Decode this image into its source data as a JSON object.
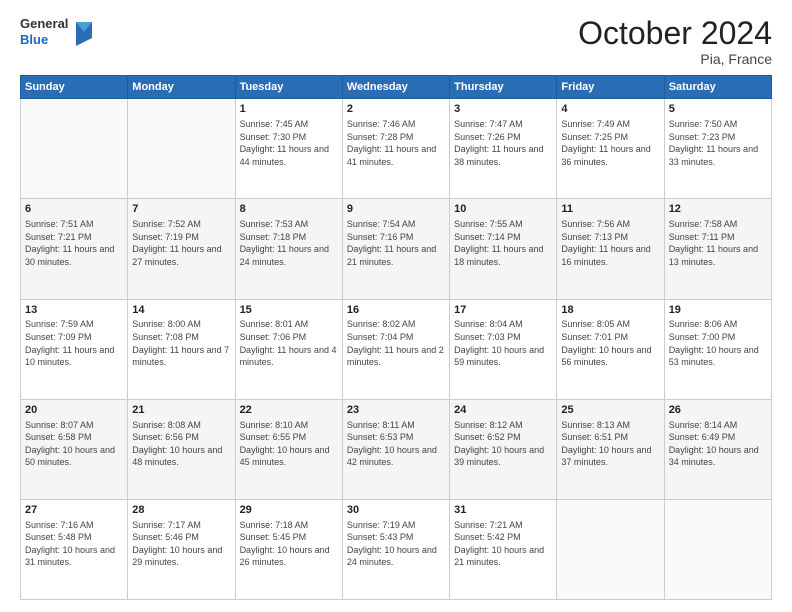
{
  "logo": {
    "general": "General",
    "blue": "Blue"
  },
  "header": {
    "month": "October 2024",
    "location": "Pia, France"
  },
  "days_of_week": [
    "Sunday",
    "Monday",
    "Tuesday",
    "Wednesday",
    "Thursday",
    "Friday",
    "Saturday"
  ],
  "weeks": [
    [
      {
        "day": "",
        "info": ""
      },
      {
        "day": "",
        "info": ""
      },
      {
        "day": "1",
        "info": "Sunrise: 7:45 AM\nSunset: 7:30 PM\nDaylight: 11 hours and 44 minutes."
      },
      {
        "day": "2",
        "info": "Sunrise: 7:46 AM\nSunset: 7:28 PM\nDaylight: 11 hours and 41 minutes."
      },
      {
        "day": "3",
        "info": "Sunrise: 7:47 AM\nSunset: 7:26 PM\nDaylight: 11 hours and 38 minutes."
      },
      {
        "day": "4",
        "info": "Sunrise: 7:49 AM\nSunset: 7:25 PM\nDaylight: 11 hours and 36 minutes."
      },
      {
        "day": "5",
        "info": "Sunrise: 7:50 AM\nSunset: 7:23 PM\nDaylight: 11 hours and 33 minutes."
      }
    ],
    [
      {
        "day": "6",
        "info": "Sunrise: 7:51 AM\nSunset: 7:21 PM\nDaylight: 11 hours and 30 minutes."
      },
      {
        "day": "7",
        "info": "Sunrise: 7:52 AM\nSunset: 7:19 PM\nDaylight: 11 hours and 27 minutes."
      },
      {
        "day": "8",
        "info": "Sunrise: 7:53 AM\nSunset: 7:18 PM\nDaylight: 11 hours and 24 minutes."
      },
      {
        "day": "9",
        "info": "Sunrise: 7:54 AM\nSunset: 7:16 PM\nDaylight: 11 hours and 21 minutes."
      },
      {
        "day": "10",
        "info": "Sunrise: 7:55 AM\nSunset: 7:14 PM\nDaylight: 11 hours and 18 minutes."
      },
      {
        "day": "11",
        "info": "Sunrise: 7:56 AM\nSunset: 7:13 PM\nDaylight: 11 hours and 16 minutes."
      },
      {
        "day": "12",
        "info": "Sunrise: 7:58 AM\nSunset: 7:11 PM\nDaylight: 11 hours and 13 minutes."
      }
    ],
    [
      {
        "day": "13",
        "info": "Sunrise: 7:59 AM\nSunset: 7:09 PM\nDaylight: 11 hours and 10 minutes."
      },
      {
        "day": "14",
        "info": "Sunrise: 8:00 AM\nSunset: 7:08 PM\nDaylight: 11 hours and 7 minutes."
      },
      {
        "day": "15",
        "info": "Sunrise: 8:01 AM\nSunset: 7:06 PM\nDaylight: 11 hours and 4 minutes."
      },
      {
        "day": "16",
        "info": "Sunrise: 8:02 AM\nSunset: 7:04 PM\nDaylight: 11 hours and 2 minutes."
      },
      {
        "day": "17",
        "info": "Sunrise: 8:04 AM\nSunset: 7:03 PM\nDaylight: 10 hours and 59 minutes."
      },
      {
        "day": "18",
        "info": "Sunrise: 8:05 AM\nSunset: 7:01 PM\nDaylight: 10 hours and 56 minutes."
      },
      {
        "day": "19",
        "info": "Sunrise: 8:06 AM\nSunset: 7:00 PM\nDaylight: 10 hours and 53 minutes."
      }
    ],
    [
      {
        "day": "20",
        "info": "Sunrise: 8:07 AM\nSunset: 6:58 PM\nDaylight: 10 hours and 50 minutes."
      },
      {
        "day": "21",
        "info": "Sunrise: 8:08 AM\nSunset: 6:56 PM\nDaylight: 10 hours and 48 minutes."
      },
      {
        "day": "22",
        "info": "Sunrise: 8:10 AM\nSunset: 6:55 PM\nDaylight: 10 hours and 45 minutes."
      },
      {
        "day": "23",
        "info": "Sunrise: 8:11 AM\nSunset: 6:53 PM\nDaylight: 10 hours and 42 minutes."
      },
      {
        "day": "24",
        "info": "Sunrise: 8:12 AM\nSunset: 6:52 PM\nDaylight: 10 hours and 39 minutes."
      },
      {
        "day": "25",
        "info": "Sunrise: 8:13 AM\nSunset: 6:51 PM\nDaylight: 10 hours and 37 minutes."
      },
      {
        "day": "26",
        "info": "Sunrise: 8:14 AM\nSunset: 6:49 PM\nDaylight: 10 hours and 34 minutes."
      }
    ],
    [
      {
        "day": "27",
        "info": "Sunrise: 7:16 AM\nSunset: 5:48 PM\nDaylight: 10 hours and 31 minutes."
      },
      {
        "day": "28",
        "info": "Sunrise: 7:17 AM\nSunset: 5:46 PM\nDaylight: 10 hours and 29 minutes."
      },
      {
        "day": "29",
        "info": "Sunrise: 7:18 AM\nSunset: 5:45 PM\nDaylight: 10 hours and 26 minutes."
      },
      {
        "day": "30",
        "info": "Sunrise: 7:19 AM\nSunset: 5:43 PM\nDaylight: 10 hours and 24 minutes."
      },
      {
        "day": "31",
        "info": "Sunrise: 7:21 AM\nSunset: 5:42 PM\nDaylight: 10 hours and 21 minutes."
      },
      {
        "day": "",
        "info": ""
      },
      {
        "day": "",
        "info": ""
      }
    ]
  ]
}
